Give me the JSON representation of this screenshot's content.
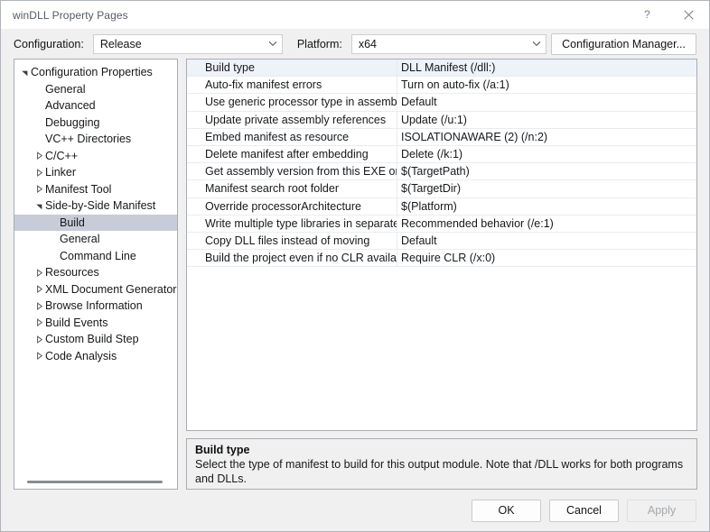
{
  "window": {
    "title": "winDLL Property Pages",
    "help_icon": "help-question-icon",
    "close_icon": "close-icon"
  },
  "toolbar": {
    "configuration_label": "Configuration:",
    "configuration_value": "Release",
    "platform_label": "Platform:",
    "platform_value": "x64",
    "configuration_manager_label": "Configuration Manager..."
  },
  "tree": {
    "nodes": [
      {
        "label": "Configuration Properties",
        "indent": 0,
        "state": "expanded",
        "selected": false
      },
      {
        "label": "General",
        "indent": 1,
        "state": "leaf",
        "selected": false
      },
      {
        "label": "Advanced",
        "indent": 1,
        "state": "leaf",
        "selected": false
      },
      {
        "label": "Debugging",
        "indent": 1,
        "state": "leaf",
        "selected": false
      },
      {
        "label": "VC++ Directories",
        "indent": 1,
        "state": "leaf",
        "selected": false
      },
      {
        "label": "C/C++",
        "indent": 1,
        "state": "collapsed",
        "selected": false
      },
      {
        "label": "Linker",
        "indent": 1,
        "state": "collapsed",
        "selected": false
      },
      {
        "label": "Manifest Tool",
        "indent": 1,
        "state": "collapsed",
        "selected": false
      },
      {
        "label": "Side-by-Side Manifest",
        "indent": 1,
        "state": "expanded",
        "selected": false
      },
      {
        "label": "Build",
        "indent": 2,
        "state": "leaf",
        "selected": true
      },
      {
        "label": "General",
        "indent": 2,
        "state": "leaf",
        "selected": false
      },
      {
        "label": "Command Line",
        "indent": 2,
        "state": "leaf",
        "selected": false
      },
      {
        "label": "Resources",
        "indent": 1,
        "state": "collapsed",
        "selected": false
      },
      {
        "label": "XML Document Generator",
        "indent": 1,
        "state": "collapsed",
        "selected": false
      },
      {
        "label": "Browse Information",
        "indent": 1,
        "state": "collapsed",
        "selected": false
      },
      {
        "label": "Build Events",
        "indent": 1,
        "state": "collapsed",
        "selected": false
      },
      {
        "label": "Custom Build Step",
        "indent": 1,
        "state": "collapsed",
        "selected": false
      },
      {
        "label": "Code Analysis",
        "indent": 1,
        "state": "collapsed",
        "selected": false
      }
    ],
    "horizontal_scrollbar": "tree-horizontal-scrollbar"
  },
  "grid": {
    "rows": [
      {
        "name": "Build type",
        "value": "DLL Manifest (/dll:)",
        "selected": true
      },
      {
        "name": "Auto-fix manifest errors",
        "value": "Turn on auto-fix (/a:1)",
        "selected": false
      },
      {
        "name": "Use generic processor type in assembly",
        "value": "Default",
        "selected": false
      },
      {
        "name": "Update private assembly references",
        "value": "Update (/u:1)",
        "selected": false
      },
      {
        "name": "Embed manifest as resource",
        "value": "ISOLATIONAWARE (2) (/n:2)",
        "selected": false
      },
      {
        "name": "Delete manifest after embedding",
        "value": "Delete (/k:1)",
        "selected": false
      },
      {
        "name": "Get assembly version from this EXE or DLL",
        "value": "$(TargetPath)",
        "selected": false
      },
      {
        "name": "Manifest search root folder",
        "value": "$(TargetDir)",
        "selected": false
      },
      {
        "name": "Override processorArchitecture",
        "value": "$(Platform)",
        "selected": false
      },
      {
        "name": "Write multiple type libraries in separate files",
        "value": "Recommended behavior (/e:1)",
        "selected": false
      },
      {
        "name": "Copy DLL files instead of moving",
        "value": "Default",
        "selected": false
      },
      {
        "name": "Build the project even if no CLR available",
        "value": "Require CLR (/x:0)",
        "selected": false
      }
    ]
  },
  "description": {
    "title": "Build type",
    "text": "Select the type of manifest to build for this output module. Note that /DLL works for both programs and DLLs."
  },
  "footer": {
    "ok_label": "OK",
    "cancel_label": "Cancel",
    "apply_label": "Apply",
    "apply_disabled": true
  }
}
